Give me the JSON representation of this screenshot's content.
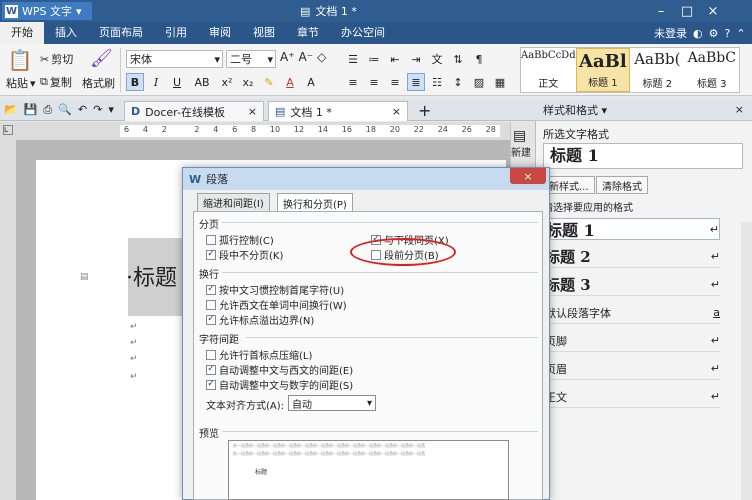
{
  "titlebar": {
    "app_name": "WPS 文字",
    "doc_title": "文档 1 *",
    "min": "–",
    "restore": "□",
    "close": "×"
  },
  "menubar": {
    "items": [
      "开始",
      "插入",
      "页面布局",
      "引用",
      "审阅",
      "视图",
      "章节",
      "办公空间"
    ],
    "login": "未登录"
  },
  "ribbon": {
    "paste": "粘贴",
    "cut": "剪切",
    "copy": "复制",
    "format_painter": "格式刷",
    "font_name": "宋体",
    "font_size": "二号",
    "styles": [
      {
        "preview": "AaBbCcDd",
        "name": "正文"
      },
      {
        "preview": "AaBl",
        "name": "标题 1"
      },
      {
        "preview": "AaBb(",
        "name": "标题 2"
      },
      {
        "preview": "AaBbC",
        "name": "标题 3"
      }
    ]
  },
  "tabs": [
    {
      "label": "Docer-在线模板"
    },
    {
      "label": "文档 1 *"
    }
  ],
  "ruler_ticks": [
    "6",
    "4",
    "2",
    "",
    "2",
    "4",
    "6",
    "8",
    "10",
    "12",
    "14",
    "16",
    "18",
    "20",
    "22",
    "24",
    "26",
    "28"
  ],
  "document": {
    "heading": "·标题",
    "para_mark": "↵",
    "new_button": "新建"
  },
  "pane": {
    "title": "样式和格式 ▾",
    "selected_label": "所选文字格式",
    "selected_style": "标题 1",
    "new_style": "新样式...",
    "clear_format": "清除格式",
    "choose_label": "请选择要应用的格式",
    "styles": [
      {
        "name": "标题 1",
        "size": "big",
        "marker": "↵"
      },
      {
        "name": "标题 2",
        "size": "mid",
        "marker": "↵"
      },
      {
        "name": "标题 3",
        "size": "mid",
        "marker": "↵"
      },
      {
        "name": "默认段落字体",
        "size": "small",
        "marker": "a"
      },
      {
        "name": "页脚",
        "size": "small",
        "marker": "↵"
      },
      {
        "name": "页眉",
        "size": "small",
        "marker": "↵"
      },
      {
        "name": "正文",
        "size": "small",
        "marker": "↵"
      }
    ]
  },
  "dialog": {
    "title": "段落",
    "close": "×",
    "tabs": [
      {
        "label": "缩进和间距(I)",
        "selected": false
      },
      {
        "label": "换行和分页(P)",
        "selected": true
      }
    ],
    "pagination_header": "分页",
    "pagination_left": [
      {
        "label": "孤行控制(C)",
        "checked": false
      },
      {
        "label": "段中不分页(K)",
        "checked": true
      }
    ],
    "pagination_right": [
      {
        "label": "与下段同页(X)",
        "checked": true
      },
      {
        "label": "段前分页(B)",
        "checked": false
      }
    ],
    "linebreak_header": "换行",
    "linebreak": [
      {
        "label": "按中文习惯控制首尾字符(U)",
        "checked": true
      },
      {
        "label": "允许西文在单词中间换行(W)",
        "checked": false
      },
      {
        "label": "允许标点溢出边界(N)",
        "checked": true
      }
    ],
    "spacing_header": "字符间距",
    "spacing": [
      {
        "label": "允许行首标点压缩(L)",
        "checked": false
      },
      {
        "label": "自动调整中文与西文的间距(E)",
        "checked": true
      },
      {
        "label": "自动调整中文与数字的间距(S)",
        "checked": true
      }
    ],
    "align_label": "文本对齐方式(A):",
    "align_value": "自动",
    "preview_label": "预览",
    "preview_text": "前一段落前一段落前一段落前一段落前一段落前一段落前一段落前一段落前一段落前一段落前一段落前一段落",
    "preview_heading": "标题"
  }
}
